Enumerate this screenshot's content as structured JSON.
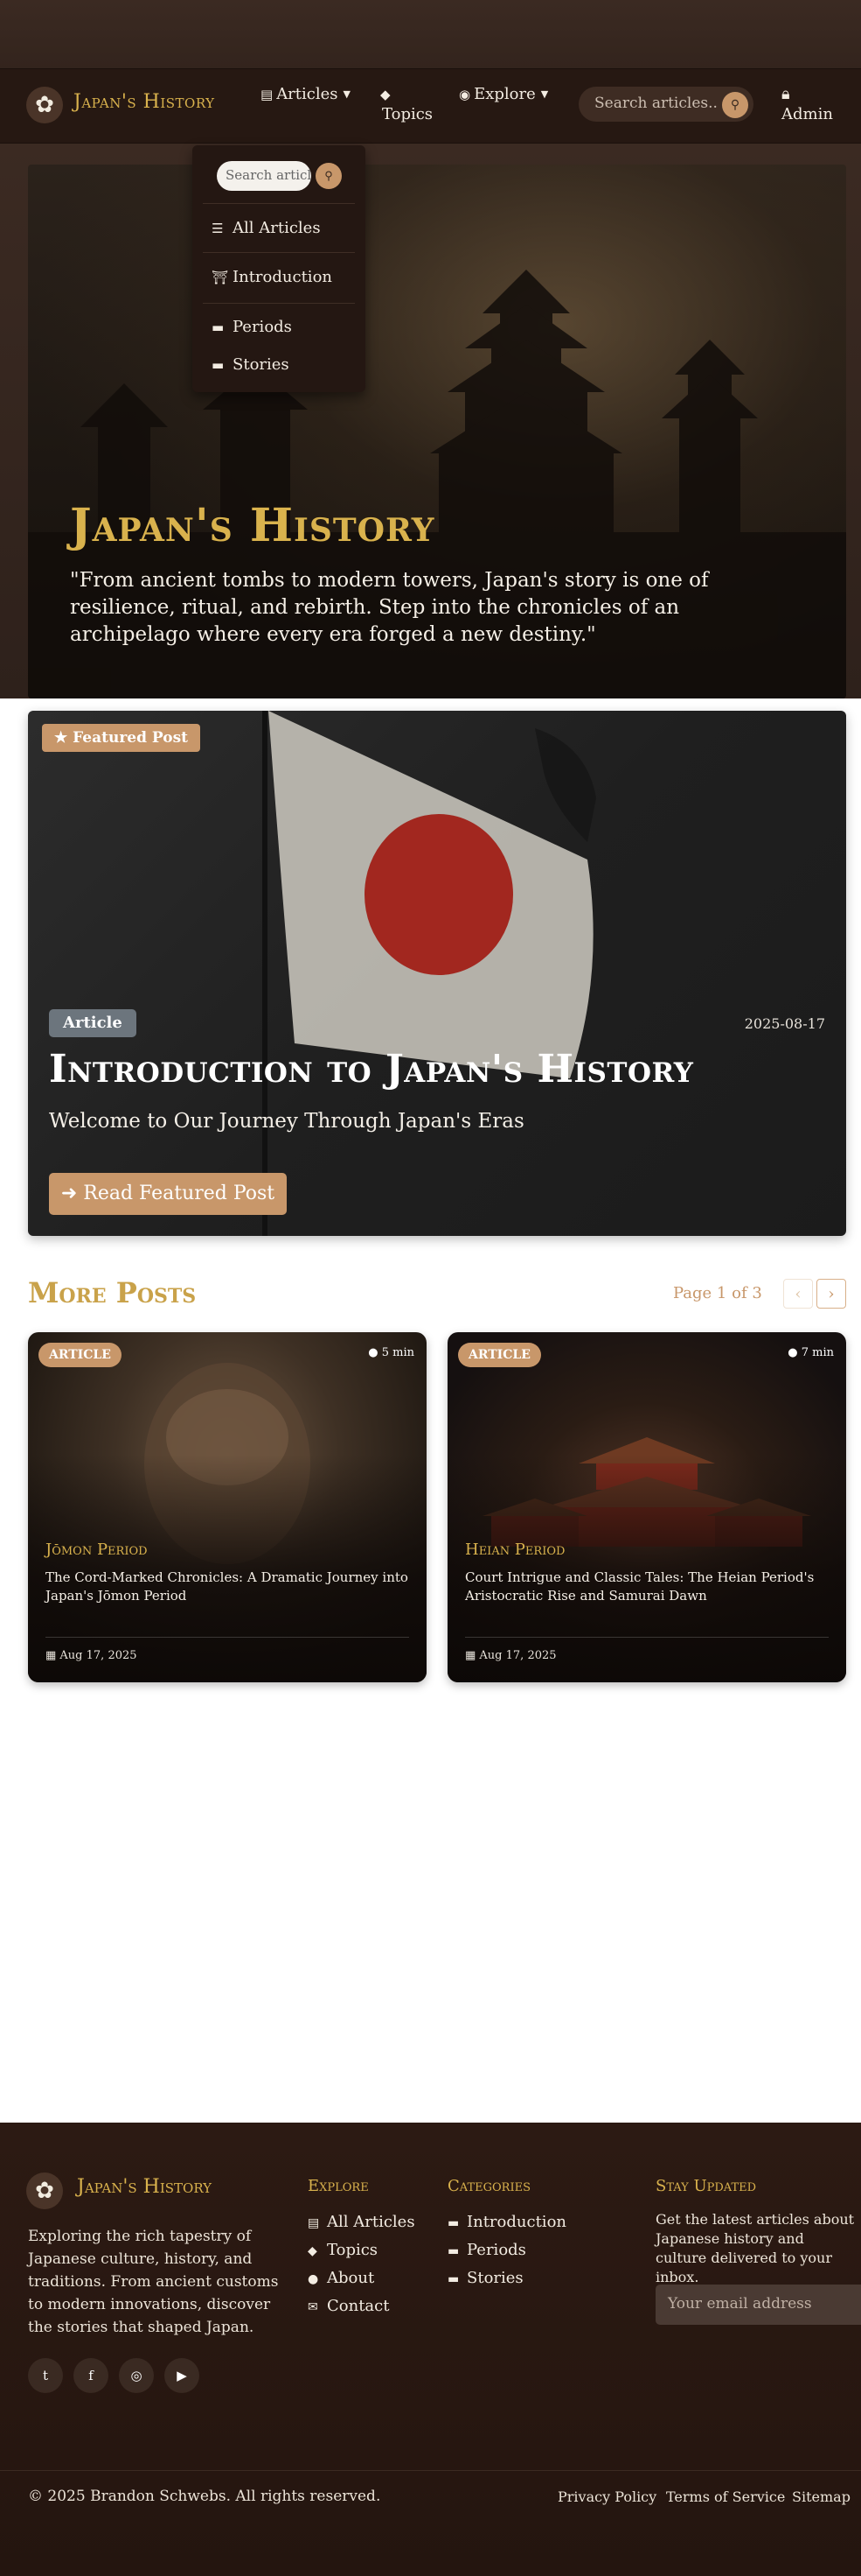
{
  "brand": {
    "name": "Japan's History",
    "logo_glyph": "✿"
  },
  "nav": {
    "articles_label": "Articles",
    "topics_label": "Topics",
    "explore_label": "Explore",
    "search_placeholder": "Search articles...",
    "admin_label": "Admin"
  },
  "dropdown": {
    "search_placeholder": "Search articles...",
    "items": [
      {
        "label": "All Articles",
        "icon": "list-icon"
      },
      {
        "label": "Introduction",
        "icon": "torii-icon"
      },
      {
        "label": "Periods",
        "icon": "folder-icon"
      },
      {
        "label": "Stories",
        "icon": "folder-icon"
      }
    ]
  },
  "hero": {
    "title": "Japan's History",
    "quote": "\"From ancient tombs to modern towers, Japan's story is one of resilience, ritual, and rebirth. Step into the chronicles of an archipelago where every era forged a new destiny.\""
  },
  "featured": {
    "badge": "Featured Post",
    "type": "Article",
    "date": "2025-08-17",
    "title": "Introduction to Japan's History",
    "subtitle": "Welcome to Our Journey Through Japan's Eras",
    "button": "Read Featured Post"
  },
  "more_posts": {
    "title": "More Posts",
    "page_info": "Page 1 of 3",
    "cards": [
      {
        "badge": "ARTICLE",
        "read_time": "5 min",
        "period": "Jōmon Period",
        "title": "The Cord-Marked Chronicles: A Dramatic Journey into Japan's Jōmon Period",
        "date": "Aug 17, 2025"
      },
      {
        "badge": "ARTICLE",
        "read_time": "7 min",
        "period": "Heian Period",
        "title": "Court Intrigue and Classic Tales: The Heian Period's Aristocratic Rise and Samurai Dawn",
        "date": "Aug 17, 2025"
      }
    ]
  },
  "footer": {
    "brand": "Japan's History",
    "description": "Exploring the rich tapestry of Japanese culture, history, and traditions. From ancient customs to modern innovations, discover the stories that shaped Japan.",
    "explore": {
      "heading": "Explore",
      "links": [
        "All Articles",
        "Topics",
        "About",
        "Contact"
      ]
    },
    "categories": {
      "heading": "Categories",
      "links": [
        "Introduction",
        "Periods",
        "Stories"
      ]
    },
    "newsletter": {
      "heading": "Stay Updated",
      "text": "Get the latest articles about Japanese history and culture delivered to your inbox.",
      "placeholder": "Your email address"
    },
    "copyright": "© 2025 Brandon Schwebs. All rights reserved.",
    "legal": [
      "Privacy Policy",
      "Terms of Service",
      "Sitemap"
    ]
  },
  "colors": {
    "accent_gold": "#d9b24d",
    "accent_tan": "#c8976a",
    "nav_bg": "#261812",
    "footer_bg": "#2c1a13"
  }
}
